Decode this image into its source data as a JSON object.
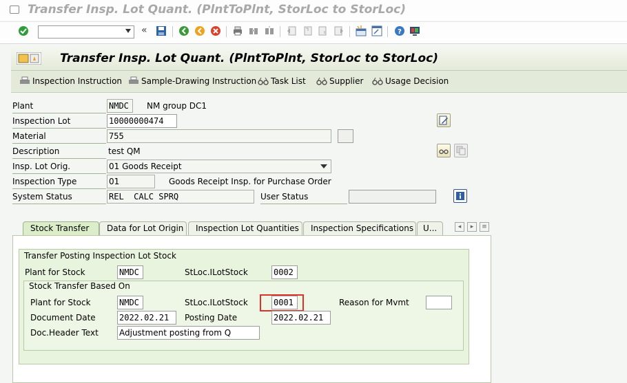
{
  "window": {
    "title": "Transfer Insp. Lot Quant. (PlntToPlnt, StorLoc to StorLoc)"
  },
  "toolbar": {
    "command_field": "",
    "icons": [
      "enter-icon",
      "command-dropdown-icon",
      "collapse-icon",
      "save-icon",
      "back-icon",
      "exit-icon",
      "cancel-icon",
      "print-icon",
      "find-icon",
      "find-next-icon",
      "first-page-icon",
      "prev-page-icon",
      "next-page-icon",
      "last-page-icon",
      "new-session-icon",
      "shortcut-icon",
      "help-icon",
      "customize-layout-icon"
    ]
  },
  "header": {
    "title": "Transfer Insp. Lot Quant. (PlntToPlnt, StorLoc to StorLoc)"
  },
  "app_toolbar": {
    "inspection_instruction": "Inspection Instruction",
    "sample_drawing_instruction": "Sample-Drawing Instruction",
    "task_list": "Task List",
    "supplier": "Supplier",
    "usage_decision": "Usage Decision"
  },
  "form": {
    "plant_label": "Plant",
    "plant_value": "NMDC",
    "plant_desc": "NM group DC1",
    "lot_label": "Inspection Lot",
    "lot_value": "10000000474",
    "material_label": "Material",
    "material_value": "755",
    "description_label": "Description",
    "description_value": "test QM",
    "origin_label": "Insp. Lot Orig.",
    "origin_value": "01 Goods Receipt",
    "type_label": "Inspection Type",
    "type_value": "01",
    "type_desc": "Goods Receipt Insp. for Purchase Order",
    "status_label": "System Status",
    "status_value": "REL  CALC SPRQ",
    "user_status_label": "User Status",
    "user_status_value": ""
  },
  "tabs": [
    {
      "label": "Stock Transfer",
      "active": true
    },
    {
      "label": "Data for Lot Origin"
    },
    {
      "label": "Inspection Lot Quantities"
    },
    {
      "label": "Inspection Specifications"
    },
    {
      "label": "U..."
    }
  ],
  "transfer": {
    "group_title": "Transfer Posting Inspection Lot Stock",
    "plant_label": "Plant for Stock",
    "plant_value": "NMDC",
    "sloc_label": "StLoc.ILotStock",
    "sloc_value": "0002",
    "sub_title": "Stock Transfer Based On",
    "sub_plant_label": "Plant for Stock",
    "sub_plant_value": "NMDC",
    "sub_sloc_label": "StLoc.ILotStock",
    "sub_sloc_value": "0001",
    "reason_label": "Reason for Mvmt",
    "reason_value": "",
    "doc_date_label": "Document Date",
    "doc_date_value": "2022.02.21",
    "post_date_label": "Posting Date",
    "post_date_value": "2022.02.21",
    "header_text_label": "Doc.Header Text",
    "header_text_value": "Adjustment posting from Q"
  },
  "colors": {
    "highlight": "#e0302a",
    "accent_green": "#2e9d3a"
  }
}
